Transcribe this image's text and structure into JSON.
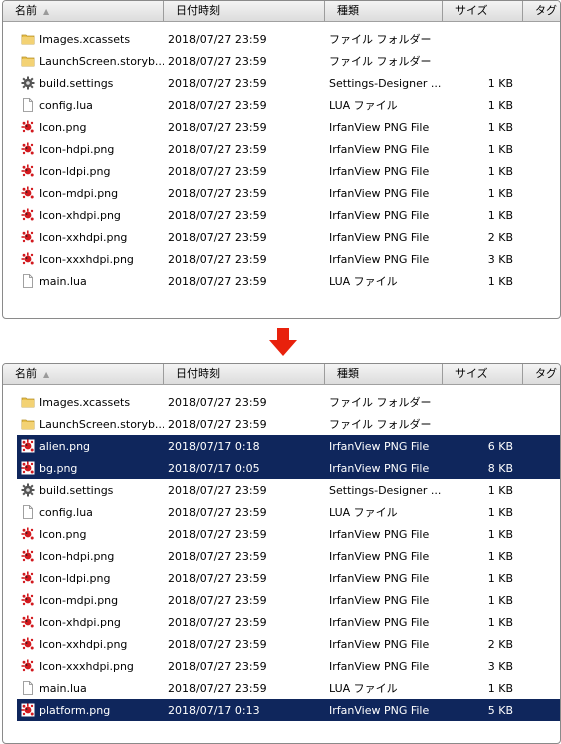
{
  "headers": {
    "name": "名前",
    "date": "日付時刻",
    "type": "種類",
    "size": "サイズ",
    "tag": "タグ"
  },
  "colors": {
    "selection": "#0f265c",
    "arrow": "#e8210c",
    "folder": "#e8c04a",
    "png_icon": "#d2191e"
  },
  "before": [
    {
      "icon": "folder-icon",
      "name": "Images.xcassets",
      "date": "2018/07/27 23:59",
      "type": "ファイル フォルダー",
      "size": ""
    },
    {
      "icon": "folder-icon",
      "name": "LaunchScreen.storyb...",
      "date": "2018/07/27 23:59",
      "type": "ファイル フォルダー",
      "size": ""
    },
    {
      "icon": "gear-icon",
      "name": "build.settings",
      "date": "2018/07/27 23:59",
      "type": "Settings-Designer ...",
      "size": "1 KB"
    },
    {
      "icon": "file-icon",
      "name": "config.lua",
      "date": "2018/07/27 23:59",
      "type": "LUA ファイル",
      "size": "1 KB"
    },
    {
      "icon": "png-icon",
      "name": "Icon.png",
      "date": "2018/07/27 23:59",
      "type": "IrfanView PNG File",
      "size": "1 KB"
    },
    {
      "icon": "png-icon",
      "name": "Icon-hdpi.png",
      "date": "2018/07/27 23:59",
      "type": "IrfanView PNG File",
      "size": "1 KB"
    },
    {
      "icon": "png-icon",
      "name": "Icon-ldpi.png",
      "date": "2018/07/27 23:59",
      "type": "IrfanView PNG File",
      "size": "1 KB"
    },
    {
      "icon": "png-icon",
      "name": "Icon-mdpi.png",
      "date": "2018/07/27 23:59",
      "type": "IrfanView PNG File",
      "size": "1 KB"
    },
    {
      "icon": "png-icon",
      "name": "Icon-xhdpi.png",
      "date": "2018/07/27 23:59",
      "type": "IrfanView PNG File",
      "size": "1 KB"
    },
    {
      "icon": "png-icon",
      "name": "Icon-xxhdpi.png",
      "date": "2018/07/27 23:59",
      "type": "IrfanView PNG File",
      "size": "2 KB"
    },
    {
      "icon": "png-icon",
      "name": "Icon-xxxhdpi.png",
      "date": "2018/07/27 23:59",
      "type": "IrfanView PNG File",
      "size": "3 KB"
    },
    {
      "icon": "file-icon",
      "name": "main.lua",
      "date": "2018/07/27 23:59",
      "type": "LUA ファイル",
      "size": "1 KB"
    }
  ],
  "after": [
    {
      "icon": "folder-icon",
      "name": "Images.xcassets",
      "date": "2018/07/27 23:59",
      "type": "ファイル フォルダー",
      "size": "",
      "selected": false
    },
    {
      "icon": "folder-icon",
      "name": "LaunchScreen.storyb...",
      "date": "2018/07/27 23:59",
      "type": "ファイル フォルダー",
      "size": "",
      "selected": false
    },
    {
      "icon": "png-icon",
      "name": "alien.png",
      "date": "2018/07/17 0:18",
      "type": "IrfanView PNG File",
      "size": "6 KB",
      "selected": true
    },
    {
      "icon": "png-icon",
      "name": "bg.png",
      "date": "2018/07/17 0:05",
      "type": "IrfanView PNG File",
      "size": "8 KB",
      "selected": true
    },
    {
      "icon": "gear-icon",
      "name": "build.settings",
      "date": "2018/07/27 23:59",
      "type": "Settings-Designer ...",
      "size": "1 KB",
      "selected": false
    },
    {
      "icon": "file-icon",
      "name": "config.lua",
      "date": "2018/07/27 23:59",
      "type": "LUA ファイル",
      "size": "1 KB",
      "selected": false
    },
    {
      "icon": "png-icon",
      "name": "Icon.png",
      "date": "2018/07/27 23:59",
      "type": "IrfanView PNG File",
      "size": "1 KB",
      "selected": false
    },
    {
      "icon": "png-icon",
      "name": "Icon-hdpi.png",
      "date": "2018/07/27 23:59",
      "type": "IrfanView PNG File",
      "size": "1 KB",
      "selected": false
    },
    {
      "icon": "png-icon",
      "name": "Icon-ldpi.png",
      "date": "2018/07/27 23:59",
      "type": "IrfanView PNG File",
      "size": "1 KB",
      "selected": false
    },
    {
      "icon": "png-icon",
      "name": "Icon-mdpi.png",
      "date": "2018/07/27 23:59",
      "type": "IrfanView PNG File",
      "size": "1 KB",
      "selected": false
    },
    {
      "icon": "png-icon",
      "name": "Icon-xhdpi.png",
      "date": "2018/07/27 23:59",
      "type": "IrfanView PNG File",
      "size": "1 KB",
      "selected": false
    },
    {
      "icon": "png-icon",
      "name": "Icon-xxhdpi.png",
      "date": "2018/07/27 23:59",
      "type": "IrfanView PNG File",
      "size": "2 KB",
      "selected": false
    },
    {
      "icon": "png-icon",
      "name": "Icon-xxxhdpi.png",
      "date": "2018/07/27 23:59",
      "type": "IrfanView PNG File",
      "size": "3 KB",
      "selected": false
    },
    {
      "icon": "file-icon",
      "name": "main.lua",
      "date": "2018/07/27 23:59",
      "type": "LUA ファイル",
      "size": "1 KB",
      "selected": false
    },
    {
      "icon": "png-icon",
      "name": "platform.png",
      "date": "2018/07/17 0:13",
      "type": "IrfanView PNG File",
      "size": "5 KB",
      "selected": true
    }
  ]
}
